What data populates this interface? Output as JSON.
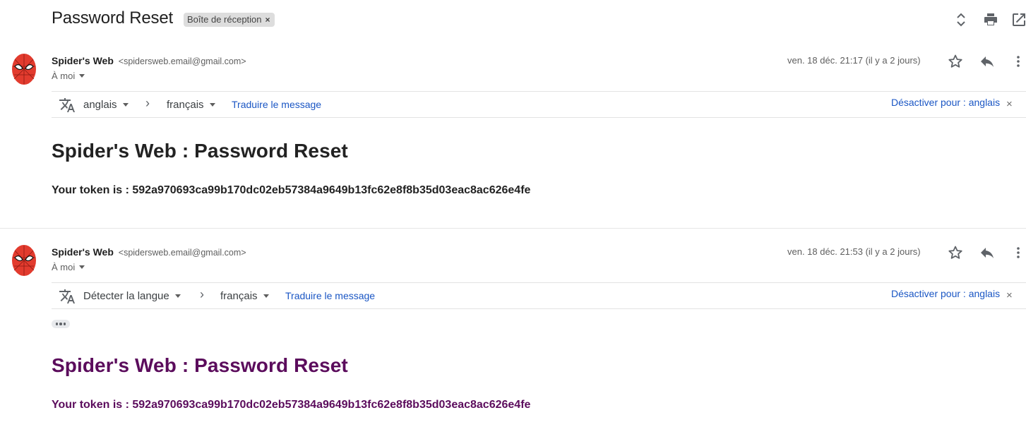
{
  "thread": {
    "subject": "Password Reset",
    "label": "Boîte de réception",
    "label_remove": "×"
  },
  "messages": [
    {
      "sender_name": "Spider's Web",
      "sender_email": "<spidersweb.email@gmail.com>",
      "to": "À moi",
      "date": "ven. 18 déc. 21:17 (il y a 2 jours)",
      "translate": {
        "source_lang": "anglais",
        "target_lang": "français",
        "translate_link": "Traduire le message",
        "disable_link": "Désactiver pour : anglais",
        "close": "×"
      },
      "heading": "Spider's Web : Password Reset",
      "token_line": "Your token is : 592a970693ca99b170dc02eb57384a9649b13fc62e8f8b35d03eac8ac626e4fe"
    },
    {
      "sender_name": "Spider's Web",
      "sender_email": "<spidersweb.email@gmail.com>",
      "to": "À moi",
      "date": "ven. 18 déc. 21:53 (il y a 2 jours)",
      "translate": {
        "source_lang": "Détecter la langue",
        "target_lang": "français",
        "translate_link": "Traduire le message",
        "disable_link": "Désactiver pour : anglais",
        "close": "×"
      },
      "heading": "Spider's Web : Password Reset",
      "token_line": "Your token is : 592a970693ca99b170dc02eb57384a9649b13fc62e8f8b35d03eac8ac626e4fe"
    }
  ],
  "colors": {
    "link": "#1a56c4",
    "visited_text": "#5b0c5c",
    "avatar_red": "#e23b2e"
  },
  "icons": [
    "expand-collapse-icon",
    "print-icon",
    "open-in-new-window-icon",
    "star-icon",
    "reply-icon",
    "more-vert-icon",
    "translate-icon",
    "chevron-right-icon",
    "dropdown-arrow-icon",
    "spiderman-avatar-icon"
  ]
}
